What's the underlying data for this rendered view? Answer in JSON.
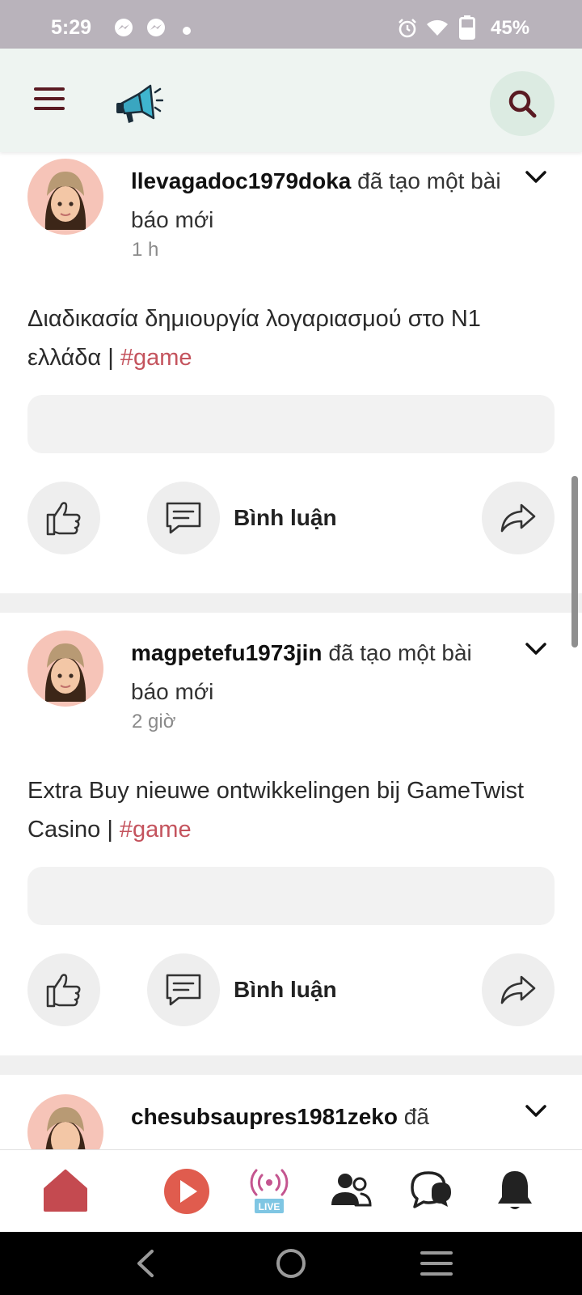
{
  "status_bar": {
    "time": "5:29",
    "battery": "45%",
    "icons": [
      "messenger-icon",
      "messenger-icon",
      "dot-icon",
      "alarm-icon",
      "wifi-icon",
      "battery-icon"
    ]
  },
  "header": {
    "menu_icon": "hamburger-menu-icon",
    "logo_icon": "megaphone-icon",
    "search_icon": "search-icon",
    "accent": "#5a1a22"
  },
  "posts": [
    {
      "username": "llevagadoc1979doka",
      "action": "đã tạo một bài báo mới",
      "time": "1 h",
      "text": "Διαδικασία δημιουργία λογαριασμού στο N1 ελλάδα | ",
      "hashtag": "#game",
      "comment_label": "Bình luận"
    },
    {
      "username": "magpetefu1973jin",
      "action": "đã tạo một bài báo mới",
      "time": "2 giờ",
      "text": "Extra Buy nieuwe ontwikkelingen bij GameTwist Casino | ",
      "hashtag": "#game",
      "comment_label": "Bình luận"
    },
    {
      "username": "chesubsaupres1981zeko",
      "action": "đã"
    }
  ],
  "bottom_nav": {
    "items": [
      "home-icon",
      "play-icon",
      "live-icon",
      "friends-icon",
      "chat-icon",
      "bell-icon"
    ],
    "live_label": "LIVE",
    "home_color": "#c44a50",
    "play_color": "#e05c4e"
  },
  "system_nav": [
    "back-icon",
    "home-circle-icon",
    "recents-icon"
  ]
}
